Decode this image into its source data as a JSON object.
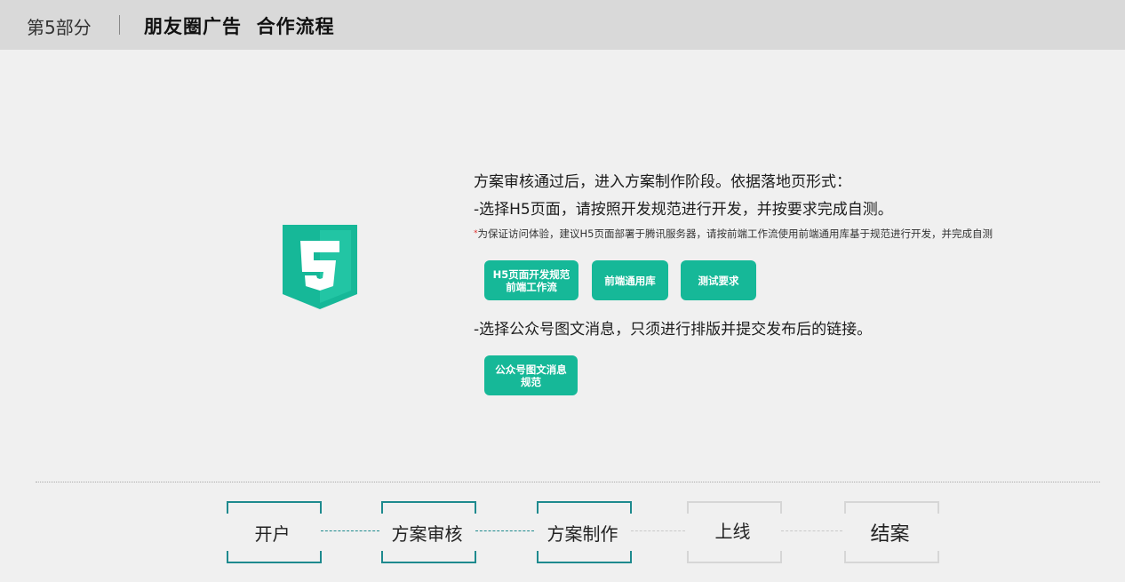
{
  "header": {
    "section": "第5部分",
    "title": "朋友圈广告  合作流程"
  },
  "logo": {
    "icon": "html5-logo-icon",
    "color": "#16b898",
    "glyph": "5"
  },
  "content": {
    "line1": "方案审核通过后，进入方案制作阶段。依据落地页形式：",
    "line2": "-选择H5页面，请按照开发规范进行开发，并按要求完成自测。",
    "note_mark": "*",
    "note": "为保证访问体验，建议H5页面部署于腾讯服务器，请按前端工作流使用前端通用库基于规范进行开发，并完成自测",
    "h5_buttons": [
      {
        "line1": "H5页面开发规范",
        "line2": "前端工作流"
      },
      {
        "line1": "前端通用库"
      },
      {
        "line1": "测试要求"
      }
    ],
    "line3": "-选择公众号图文消息，只须进行排版并提交发布后的链接。",
    "wx_button": {
      "line1": "公众号图文消息",
      "line2": "规范"
    }
  },
  "process": {
    "steps": [
      {
        "label": "开户",
        "state": "active"
      },
      {
        "label": "方案审核",
        "state": "active"
      },
      {
        "label": "方案制作",
        "state": "active"
      },
      {
        "label": "上线",
        "state": "inactive"
      },
      {
        "label": "结案",
        "state": "inactive"
      }
    ],
    "active_color": "#1e8a8e",
    "inactive_color": "#d6d6d6"
  },
  "colors": {
    "accent": "#16b898",
    "header_bg": "#d9d9d9",
    "page_bg": "#f0f0f0"
  }
}
